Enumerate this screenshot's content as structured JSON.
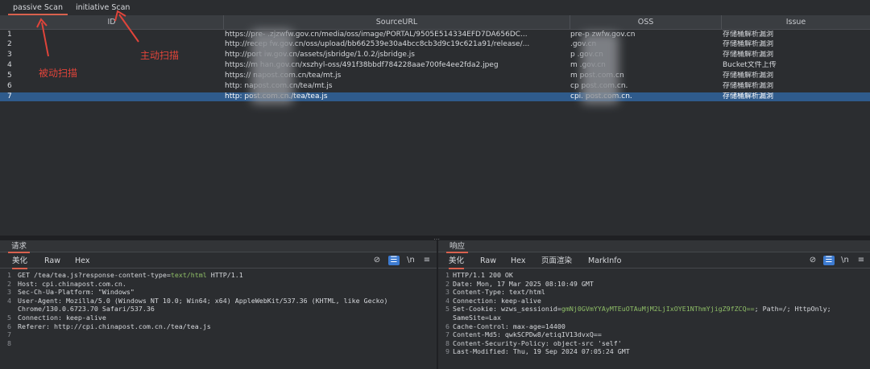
{
  "tabs": [
    {
      "label": "passive Scan",
      "active": true
    },
    {
      "label": "initiative Scan",
      "active": false
    }
  ],
  "annotations": {
    "passive": "被动扫描",
    "initiative": "主动扫描"
  },
  "table": {
    "columns": [
      "ID",
      "SourceURL",
      "OSS",
      "Issue"
    ],
    "rows": [
      {
        "id": "1",
        "url": "https://pre-       .zjzwfw.gov.cn/media/oss/image/PORTAL/9505E514334EFD7DA656DC...",
        "oss": "pre-p         zwfw.gov.cn",
        "issue": "存储桶解析漏洞"
      },
      {
        "id": "2",
        "url": "http://recep      fw.gov.cn/oss/upload/bb662539e30a4bcc8cb3d9c19c621a91/release/...",
        "oss": "            .gov.cn",
        "issue": "存储桶解析漏洞"
      },
      {
        "id": "3",
        "url": "http://port      iw.gov.cn/assets/jsbridge/1.0.2/jsbridge.js",
        "oss": "p          .gov.cn",
        "issue": "存储桶解析漏洞"
      },
      {
        "id": "4",
        "url": "https://m        han.gov.cn/xszhyl-oss/491f38bbdf784228aae700fe4ee2fda2.jpeg",
        "oss": "m           .gov.cn",
        "issue": "Bucket文件上传"
      },
      {
        "id": "5",
        "url": "https://          napost.com.cn/tea/mt.js",
        "oss": "m           post.com.cn",
        "issue": "存储桶解析漏洞"
      },
      {
        "id": "6",
        "url": "http:          napost.com.cn/tea/mt.js",
        "oss": "cp          post.com.cn.",
        "issue": "存储桶解析漏洞"
      },
      {
        "id": "7",
        "url": "http:          post.com.cn./tea/tea.js",
        "oss": "cpi.        post.com.cn.",
        "issue": "存储桶解析漏洞",
        "selected": true
      }
    ]
  },
  "request": {
    "title": "请求",
    "subtabs": [
      "美化",
      "Raw",
      "Hex"
    ],
    "lines": [
      "GET /tea/tea.js?response-content-type=text/html HTTP/1.1",
      "Host: cpi.chinapost.com.cn.",
      "Sec-Ch-Ua-Platform: \"Windows\"",
      "User-Agent: Mozilla/5.0 (Windows NT 10.0; Win64; x64) AppleWebKit/537.36 (KHTML, like Gecko)",
      "Chrome/130.0.6723.70 Safari/537.36",
      "Connection: keep-alive",
      "Referer: http://cpi.chinapost.com.cn./tea/tea.js",
      "",
      ""
    ],
    "line_numbers": [
      "1",
      "2",
      "3",
      "4",
      "",
      "5",
      "6",
      "7",
      "8"
    ]
  },
  "response": {
    "title": "响应",
    "subtabs": [
      "美化",
      "Raw",
      "Hex",
      "页面渲染",
      "MarkInfo"
    ],
    "lines": [
      "HTTP/1.1 200 OK",
      "Date: Mon, 17 Mar 2025 08:10:49 GMT",
      "Content-Type: text/html",
      "Connection: keep-alive",
      "Set-Cookie: wzws_sessionid=gmNj0GVmYYAyMTEuOTAuMjM2LjIxOYE1NThmYjigZ9fZCQ==; Path=/; HttpOnly;",
      "SameSite=Lax",
      "Cache-Control: max-age=14400",
      "Content-Md5: qwkSCPDw8/etiqIV13dvxQ==",
      "Content-Security-Policy: object-src 'self'",
      "Last-Modified: Thu, 19 Sep 2024 07:05:24 GMT"
    ],
    "line_numbers": [
      "1",
      "2",
      "3",
      "4",
      "5",
      "",
      "6",
      "7",
      "8",
      "9"
    ]
  },
  "colors": {
    "accent": "#d9614e",
    "selection": "#2f5b8c",
    "annotation": "#e0443a"
  }
}
